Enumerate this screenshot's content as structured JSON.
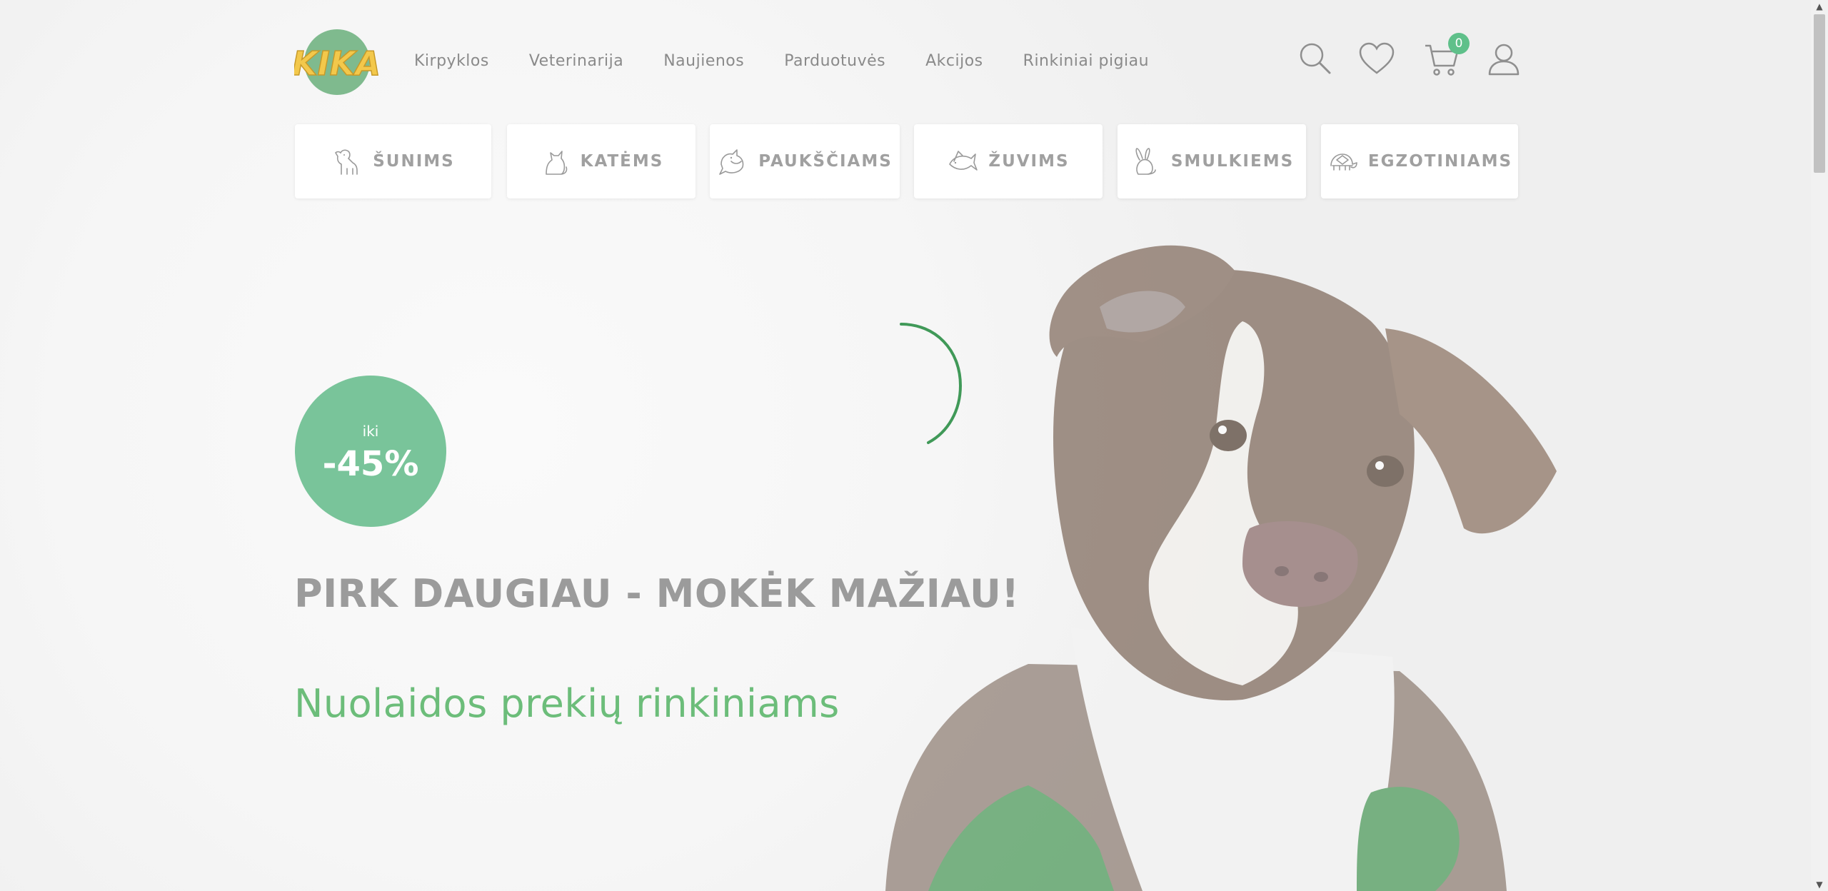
{
  "brand": {
    "logo_text": "KIKA"
  },
  "nav": {
    "items": [
      {
        "label": "Kirpyklos"
      },
      {
        "label": "Veterinarija"
      },
      {
        "label": "Naujienos"
      },
      {
        "label": "Parduotuvės"
      },
      {
        "label": "Akcijos"
      },
      {
        "label": "Rinkiniai pigiau"
      }
    ]
  },
  "header_icons": {
    "search": "search-icon",
    "wishlist": "heart-icon",
    "cart": "cart-icon",
    "account": "user-icon",
    "cart_count": "0"
  },
  "categories": [
    {
      "label": "ŠUNIMS",
      "icon": "dog-icon"
    },
    {
      "label": "KATĖMS",
      "icon": "cat-icon"
    },
    {
      "label": "PAUKŠČIAMS",
      "icon": "bird-icon"
    },
    {
      "label": "ŽUVIMS",
      "icon": "fish-icon"
    },
    {
      "label": "SMULKIEMS",
      "icon": "rabbit-icon"
    },
    {
      "label": "EGZOTINIAMS",
      "icon": "turtle-icon"
    }
  ],
  "hero": {
    "badge_prefix": "iki",
    "badge_value": "-45%",
    "headline": "PIRK DAUGIAU - MOKĖK MAŽIAU!",
    "subline": "Nuolaidos prekių rinkiniams"
  },
  "colors": {
    "accent_green": "#79c49a",
    "subline_green": "#6cbd7a",
    "logo_yellow": "#f3c84b"
  }
}
